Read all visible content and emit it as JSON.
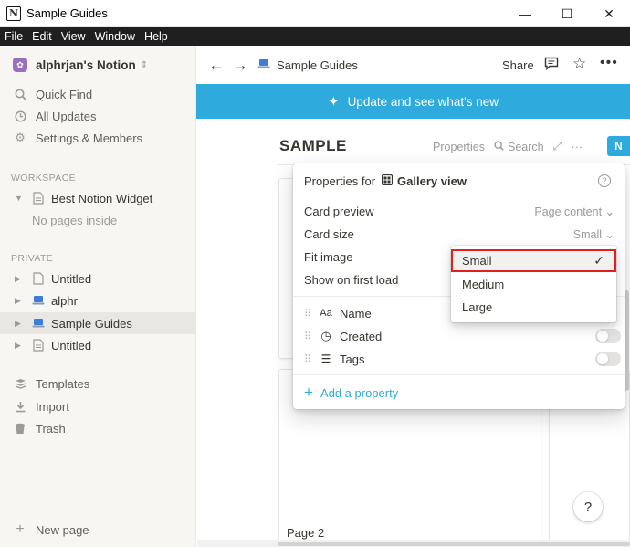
{
  "window": {
    "title": "Sample Guides",
    "minimize": "—",
    "maximize": "☐",
    "close": "✕"
  },
  "menubar": [
    "File",
    "Edit",
    "View",
    "Window",
    "Help"
  ],
  "sidebar": {
    "workspace_name": "alphrjan's Notion",
    "quick_find": "Quick Find",
    "all_updates": "All Updates",
    "settings": "Settings & Members",
    "workspace_label": "WORKSPACE",
    "workspace_pages": [
      {
        "label": "Best Notion Widget"
      }
    ],
    "no_pages": "No pages inside",
    "private_label": "PRIVATE",
    "private_pages": [
      {
        "label": "Untitled"
      },
      {
        "label": "alphr"
      },
      {
        "label": "Sample Guides"
      },
      {
        "label": "Untitled"
      }
    ],
    "templates": "Templates",
    "import": "Import",
    "trash": "Trash",
    "new_page": "New page"
  },
  "topbar": {
    "breadcrumb": "Sample Guides",
    "share": "Share"
  },
  "banner": {
    "text": "Update and see what's new"
  },
  "database": {
    "title": "SAMPLE",
    "properties": "Properties",
    "search": "Search",
    "new_button": "N",
    "card_label": "Page 2"
  },
  "properties_popup": {
    "header_prefix": "Properties for",
    "view_name": "Gallery view",
    "card_preview_label": "Card preview",
    "card_preview_value": "Page content",
    "card_size_label": "Card size",
    "card_size_value": "Small",
    "fit_image_label": "Fit image",
    "show_first_load_label": "Show on first load",
    "props": [
      {
        "label": "Name",
        "icon": "Aa"
      },
      {
        "label": "Created",
        "icon": "◷"
      },
      {
        "label": "Tags",
        "icon": "☰"
      }
    ],
    "add_property": "Add a property"
  },
  "size_dropdown": {
    "options": [
      {
        "label": "Small"
      },
      {
        "label": "Medium"
      },
      {
        "label": "Large"
      }
    ],
    "selected_check": "✓"
  },
  "help_button": "?"
}
